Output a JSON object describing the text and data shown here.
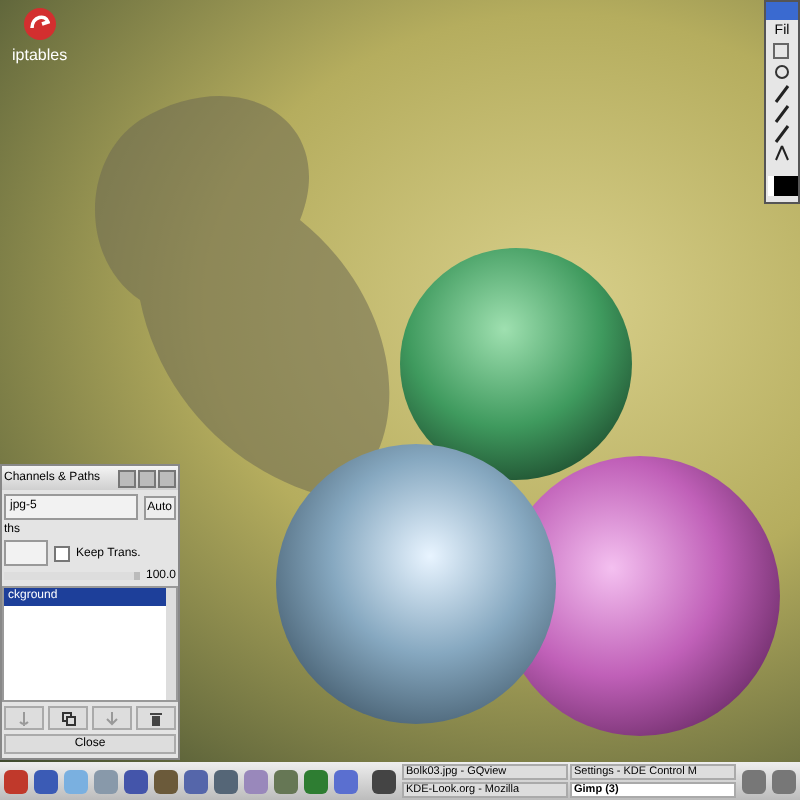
{
  "desktop_icons": [
    {
      "label": "iptables"
    }
  ],
  "layers_dialog": {
    "title": "Channels & Paths",
    "image_select": "jpg-5",
    "auto_button": "Auto",
    "mode_label": "ths",
    "keep_trans": {
      "label": "Keep Trans.",
      "checked": false
    },
    "opacity": {
      "level": 0.95,
      "reading": "100.0"
    },
    "layers": [
      {
        "name": "ckground",
        "selected": true
      }
    ],
    "close_button": "Close"
  },
  "toolbox": {
    "menu": "Fil"
  },
  "taskbar": {
    "tasks": [
      {
        "label": "Bolk03.jpg - GQview",
        "selected": false
      },
      {
        "label": "Settings - KDE Control M",
        "selected": false
      },
      {
        "label": "KDE-Look.org - Mozilla",
        "selected": false
      },
      {
        "label": "Gimp (3)",
        "selected": true
      }
    ]
  }
}
